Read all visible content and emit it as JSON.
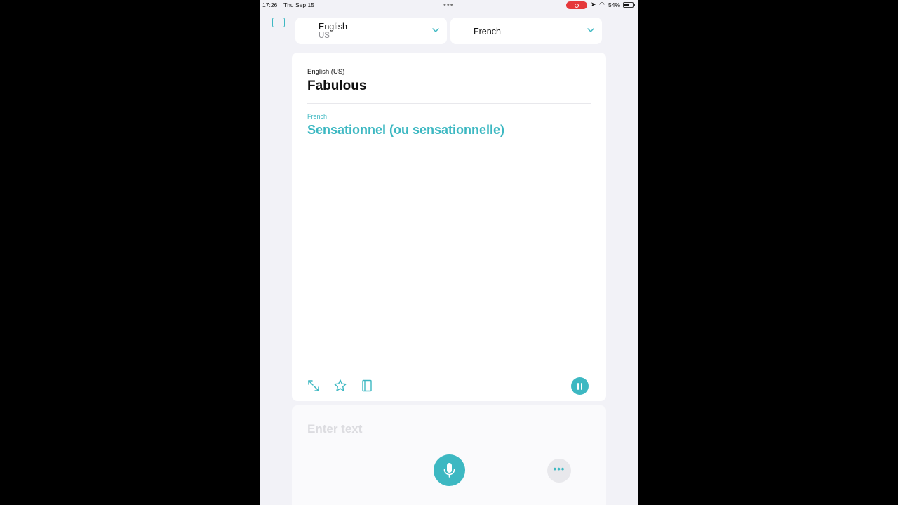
{
  "status_bar": {
    "time": "17:26",
    "date": "Thu Sep 15",
    "battery": "54%"
  },
  "colors": {
    "accent": "#3db8c2",
    "background": "#f2f2f7",
    "record": "#e5383b"
  },
  "source_language": {
    "name": "English",
    "region": "US"
  },
  "target_language": {
    "name": "French"
  },
  "translation": {
    "source_label": "English (US)",
    "source_text": "Fabulous",
    "target_label": "French",
    "target_text": "Sensationnel (ou sensationnelle)"
  },
  "toolbar_icons": [
    "expand-icon",
    "star-icon",
    "book-icon",
    "pause-icon"
  ],
  "input": {
    "placeholder": "Enter text"
  },
  "bottom_icons": [
    "microphone-icon",
    "more-icon"
  ]
}
